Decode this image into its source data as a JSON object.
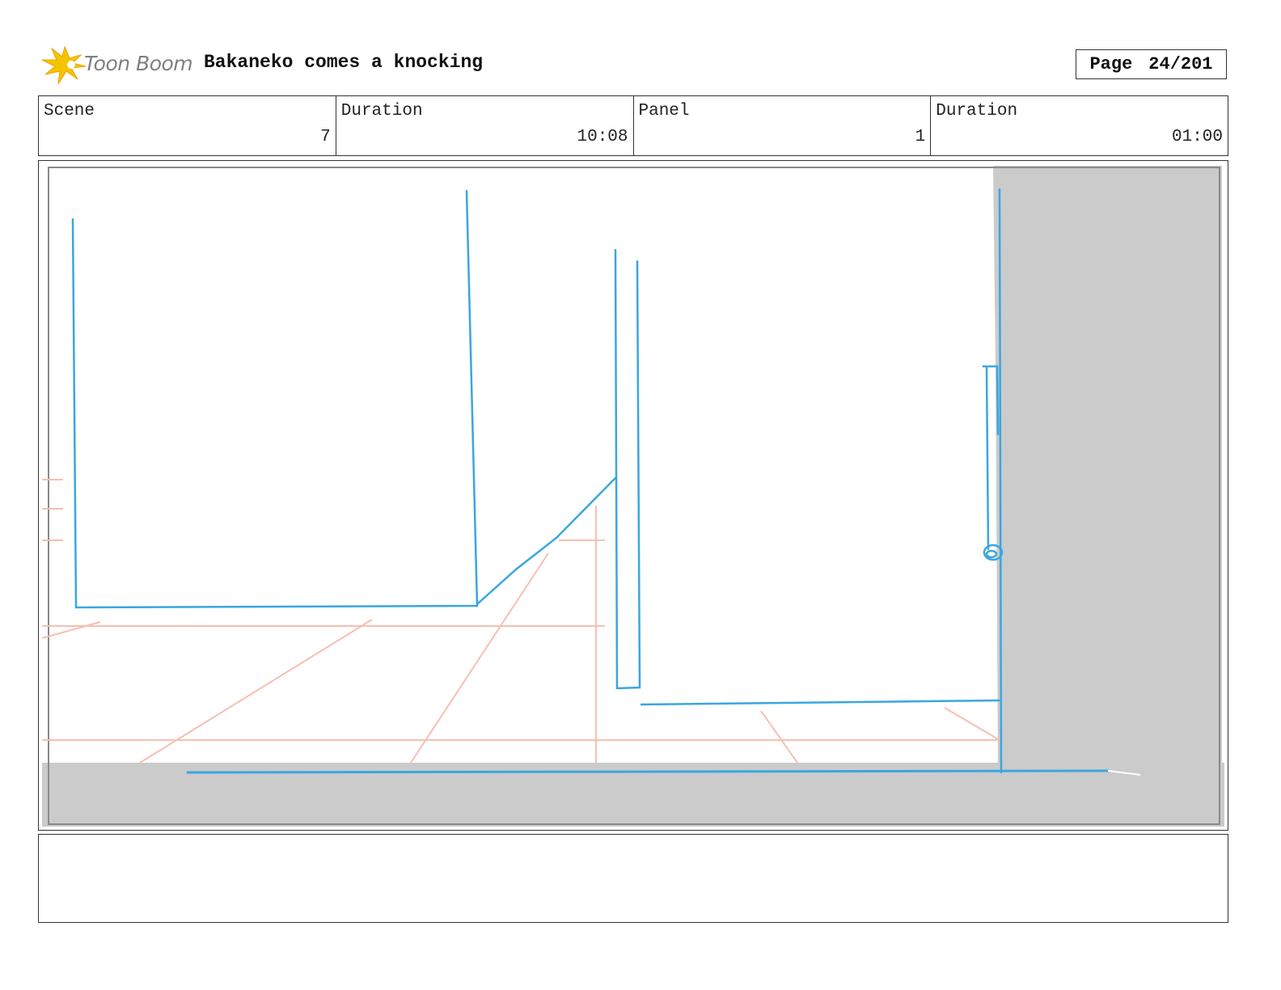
{
  "header": {
    "logo_text": "Toon Boom",
    "title": "Bakaneko comes a knocking",
    "page_label": "Page",
    "page_value": "24/201"
  },
  "info": {
    "scene_label": "Scene",
    "scene_value": "7",
    "scene_duration_label": "Duration",
    "scene_duration_value": "10:08",
    "panel_label": "Panel",
    "panel_value": "1",
    "panel_duration_label": "Duration",
    "panel_duration_value": "01:00"
  },
  "panel": {
    "description": "",
    "colors": {
      "blue_lines": "#3aa6e0",
      "guide_lines": "#f6c0b2",
      "gray_fill": "#cbcbcb"
    }
  },
  "colors": {
    "logo_yellow": "#f5c400",
    "logo_orange": "#f0a000",
    "border": "#333333"
  }
}
